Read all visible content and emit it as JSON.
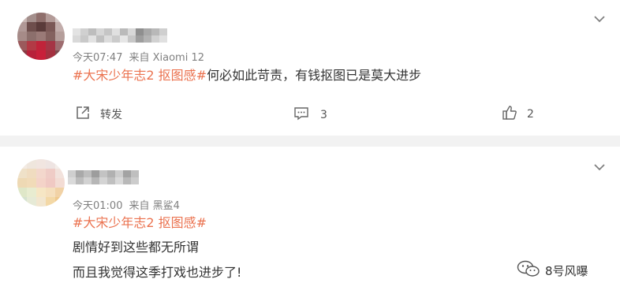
{
  "comments": [
    {
      "time": "今天07:47",
      "source": "来自 Xiaomi 12",
      "topic": "#大宋少年志2 抠图感#",
      "text": "何必如此苛责，有钱抠图已是莫大进步",
      "repost_label": "转发",
      "comment_count": "3",
      "like_count": "2"
    },
    {
      "time": "今天01:00",
      "source": "来自 黑鲨4",
      "topic": "#大宋少年志2 抠图感#",
      "lines": [
        "剧情好到这些都无所谓",
        "而且我觉得这季打戏也进步了!"
      ]
    }
  ],
  "watermark": {
    "text": "8号风曝"
  },
  "colors": {
    "topic": "#eb7350",
    "meta": "#808080",
    "text": "#333333",
    "separator": "#f2f2f2"
  }
}
